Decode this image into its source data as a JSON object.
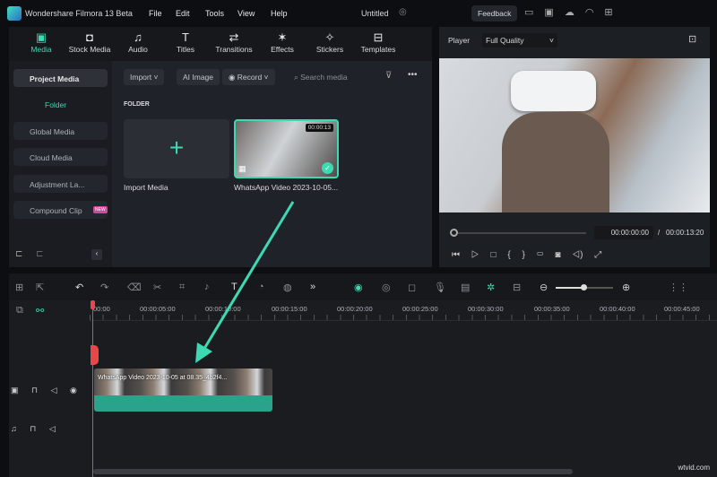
{
  "app": {
    "title": "Wondershare Filmora 13 Beta",
    "project": "Untitled",
    "feedback": "Feedback"
  },
  "menu": [
    "File",
    "Edit",
    "Tools",
    "View",
    "Help"
  ],
  "tabs": [
    {
      "label": "Media",
      "icon": "media-icon"
    },
    {
      "label": "Stock Media",
      "icon": "stock-icon"
    },
    {
      "label": "Audio",
      "icon": "music-icon"
    },
    {
      "label": "Titles",
      "icon": "text-icon"
    },
    {
      "label": "Transitions",
      "icon": "transition-icon"
    },
    {
      "label": "Effects",
      "icon": "effects-icon"
    },
    {
      "label": "Stickers",
      "icon": "sticker-icon"
    },
    {
      "label": "Templates",
      "icon": "template-icon"
    }
  ],
  "sidebar": {
    "project_media": "Project Media",
    "folder": "Folder",
    "items": [
      "Global Media",
      "Cloud Media",
      "Adjustment La...",
      "Compound Clip"
    ],
    "new_badge": "NEW"
  },
  "toolbar": {
    "import": "Import",
    "ai_image": "AI Image",
    "record": "Record",
    "search_placeholder": "Search media"
  },
  "content": {
    "section": "FOLDER",
    "import_media": "Import Media",
    "clip_name": "WhatsApp Video 2023-10-05...",
    "clip_duration": "00:00:13"
  },
  "player": {
    "label": "Player",
    "quality": "Full Quality",
    "current": "00:00:00:00",
    "separator": "/",
    "total": "00:00:13:20"
  },
  "timeline": {
    "ticks": [
      "00:00",
      "00:00:05:00",
      "00:00:10:00",
      "00:00:15:00",
      "00:00:20:00",
      "00:00:25:00",
      "00:00:30:00",
      "00:00:35:00",
      "00:00:40:00",
      "00:00:45:00"
    ],
    "clip_label": "WhatsApp Video 2023-10-05 at 08.35_4b2f4...",
    "zoom_level": 0.45
  },
  "watermark": "wtvid.com",
  "colors": {
    "accent": "#3dd9b3",
    "clip": "#2aa38a",
    "playhead": "#e8474a"
  }
}
